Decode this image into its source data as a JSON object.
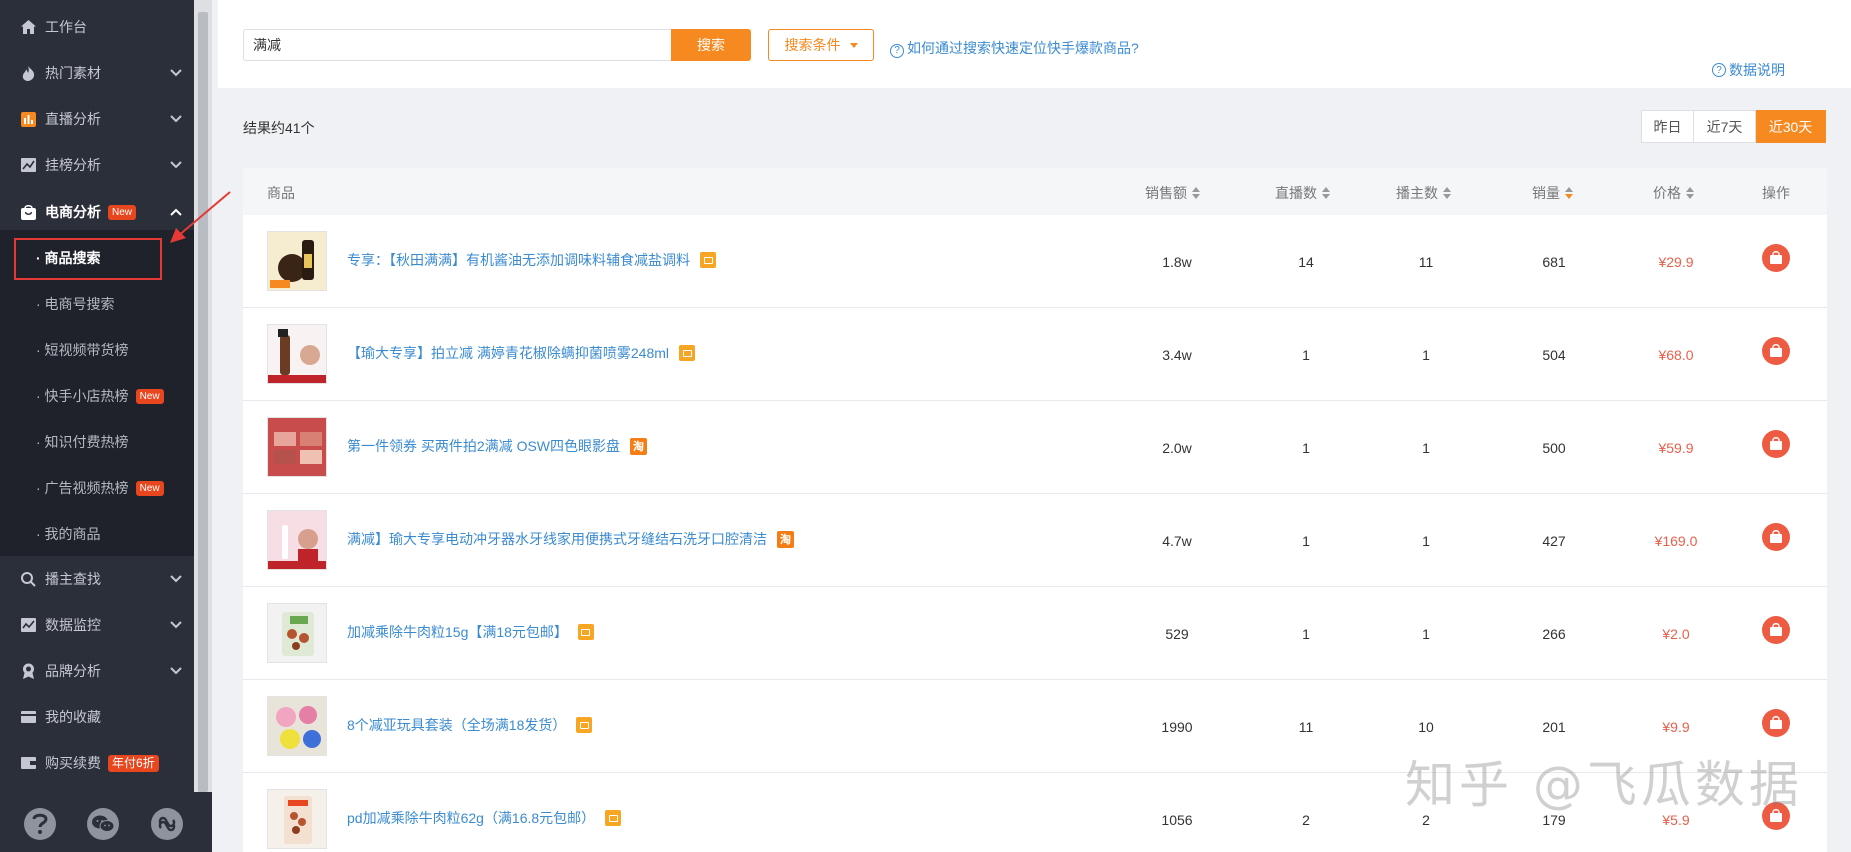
{
  "sidebar": {
    "items": [
      {
        "label": "工作台",
        "icon": "home-icon"
      },
      {
        "label": "热门素材",
        "icon": "fire-icon"
      },
      {
        "label": "直播分析",
        "icon": "bar-chart-icon"
      },
      {
        "label": "挂榜分析",
        "icon": "line-chart-icon"
      },
      {
        "label": "电商分析",
        "icon": "shopping-bag-icon",
        "badge": "New"
      }
    ],
    "sub_items": [
      {
        "label": "· 商品搜索"
      },
      {
        "label": "· 电商号搜索"
      },
      {
        "label": "· 短视频带货榜"
      },
      {
        "label": "· 快手小店热榜",
        "badge": "New"
      },
      {
        "label": "· 知识付费热榜"
      },
      {
        "label": "· 广告视频热榜",
        "badge": "New"
      },
      {
        "label": "· 我的商品"
      }
    ],
    "bottom_items": [
      {
        "label": "播主查找",
        "icon": "search-icon"
      },
      {
        "label": "数据监控",
        "icon": "monitor-chart-icon"
      },
      {
        "label": "品牌分析",
        "icon": "award-icon"
      },
      {
        "label": "我的收藏",
        "icon": "card-icon"
      },
      {
        "label": "购买续费",
        "icon": "wallet-icon",
        "badge": "年付6折"
      }
    ]
  },
  "search": {
    "value": "满减",
    "button": "搜索",
    "conditions": "搜索条件",
    "help_link": "如何通过搜索快速定位快手爆款商品?",
    "data_desc": "数据说明"
  },
  "results": {
    "count": "结果约41个",
    "date_filters": [
      "昨日",
      "近7天",
      "近30天"
    ]
  },
  "table": {
    "headers": {
      "product": "商品",
      "sales": "销售额",
      "lives": "直播数",
      "hosts": "播主数",
      "volume": "销量",
      "price": "价格",
      "action": "操作"
    },
    "rows": [
      {
        "name": "专享：【秋田满满】有机酱油无添加调味料辅食减盐调料",
        "source": "shop",
        "sales": "1.8w",
        "lives": "14",
        "hosts": "11",
        "volume": "681",
        "price": "¥29.9"
      },
      {
        "name": "【瑜大专享】拍立减 满婷青花椒除螨抑菌喷雾248ml",
        "source": "shop",
        "sales": "3.4w",
        "lives": "1",
        "hosts": "1",
        "volume": "504",
        "price": "¥68.0"
      },
      {
        "name": "第一件领券 买两件拍2满减 OSW四色眼影盘",
        "source": "taobao",
        "sales": "2.0w",
        "lives": "1",
        "hosts": "1",
        "volume": "500",
        "price": "¥59.9"
      },
      {
        "name": "满减】瑜大专享电动冲牙器水牙线家用便携式牙缝结石洗牙口腔清洁",
        "source": "taobao",
        "sales": "4.7w",
        "lives": "1",
        "hosts": "1",
        "volume": "427",
        "price": "¥169.0"
      },
      {
        "name": "加减乘除牛肉粒15g【满18元包邮】",
        "source": "shop",
        "sales": "529",
        "lives": "1",
        "hosts": "1",
        "volume": "266",
        "price": "¥2.0"
      },
      {
        "name": "8个减亚玩具套装（全场满18发货）",
        "source": "shop",
        "sales": "1990",
        "lives": "11",
        "hosts": "10",
        "volume": "201",
        "price": "¥9.9"
      },
      {
        "name": "pd加减乘除牛肉粒62g（满16.8元包邮）",
        "source": "shop",
        "sales": "1056",
        "lives": "2",
        "hosts": "2",
        "volume": "179",
        "price": "¥5.9"
      }
    ]
  },
  "watermark": "知乎 @飞瓜数据",
  "colors": {
    "accent": "#f6891f",
    "link": "#3b8bd1",
    "price": "#e8604c",
    "sidebar": "#2b2f3a"
  }
}
